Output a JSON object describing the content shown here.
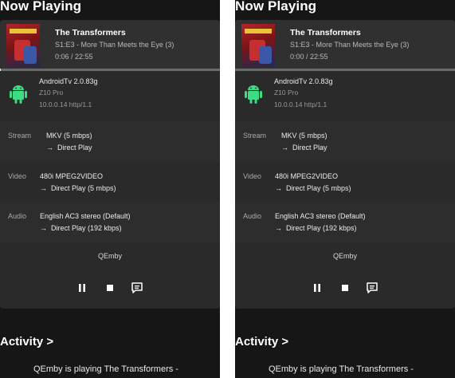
{
  "section_title": "Now Playing",
  "activity_title": "Activity",
  "activity_chevron": ">",
  "activity_text": "QEmby is playing The Transformers -",
  "arrow": "→",
  "labels": {
    "stream": "Stream",
    "video": "Video",
    "audio": "Audio"
  },
  "panels": [
    {
      "media": {
        "title": "The Transformers",
        "episode": "S1:E3 - More Than Meets the Eye (3)",
        "time": "0:06 / 22:55",
        "progress_fraction": 0.004
      },
      "device": {
        "app": "AndroidTv 2.0.83g",
        "model": "Z10 Pro",
        "address": "10.0.0.14 http/1.1",
        "icon": "android-icon"
      },
      "stream": {
        "value": "MKV (5 mbps)",
        "method": "Direct Play"
      },
      "video": {
        "value": "480i MPEG2VIDEO",
        "method": "Direct Play (5 mbps)"
      },
      "audio": {
        "value": "English AC3 stereo (Default)",
        "method": "Direct Play (192 kbps)"
      },
      "client": "QEmby"
    },
    {
      "media": {
        "title": "The Transformers",
        "episode": "S1:E3 - More Than Meets the Eye (3)",
        "time": "0:00 / 22:55",
        "progress_fraction": 0.0
      },
      "device": {
        "app": "AndroidTv 2.0.83g",
        "model": "Z10 Pro",
        "address": "10.0.0.14 http/1.1",
        "icon": "android-icon"
      },
      "stream": {
        "value": "MKV (5 mbps)",
        "method": "Direct Play"
      },
      "video": {
        "value": "480i MPEG2VIDEO",
        "method": "Direct Play (5 mbps)"
      },
      "audio": {
        "value": "English AC3 stereo (Default)",
        "method": "Direct Play (192 kbps)"
      },
      "client": "QEmby"
    }
  ],
  "controls": {
    "icons": [
      "pause-icon",
      "stop-icon",
      "message-icon"
    ]
  },
  "colors": {
    "background": "#161616",
    "card": "#2a2a2a",
    "android_green": "#3ddc84"
  }
}
